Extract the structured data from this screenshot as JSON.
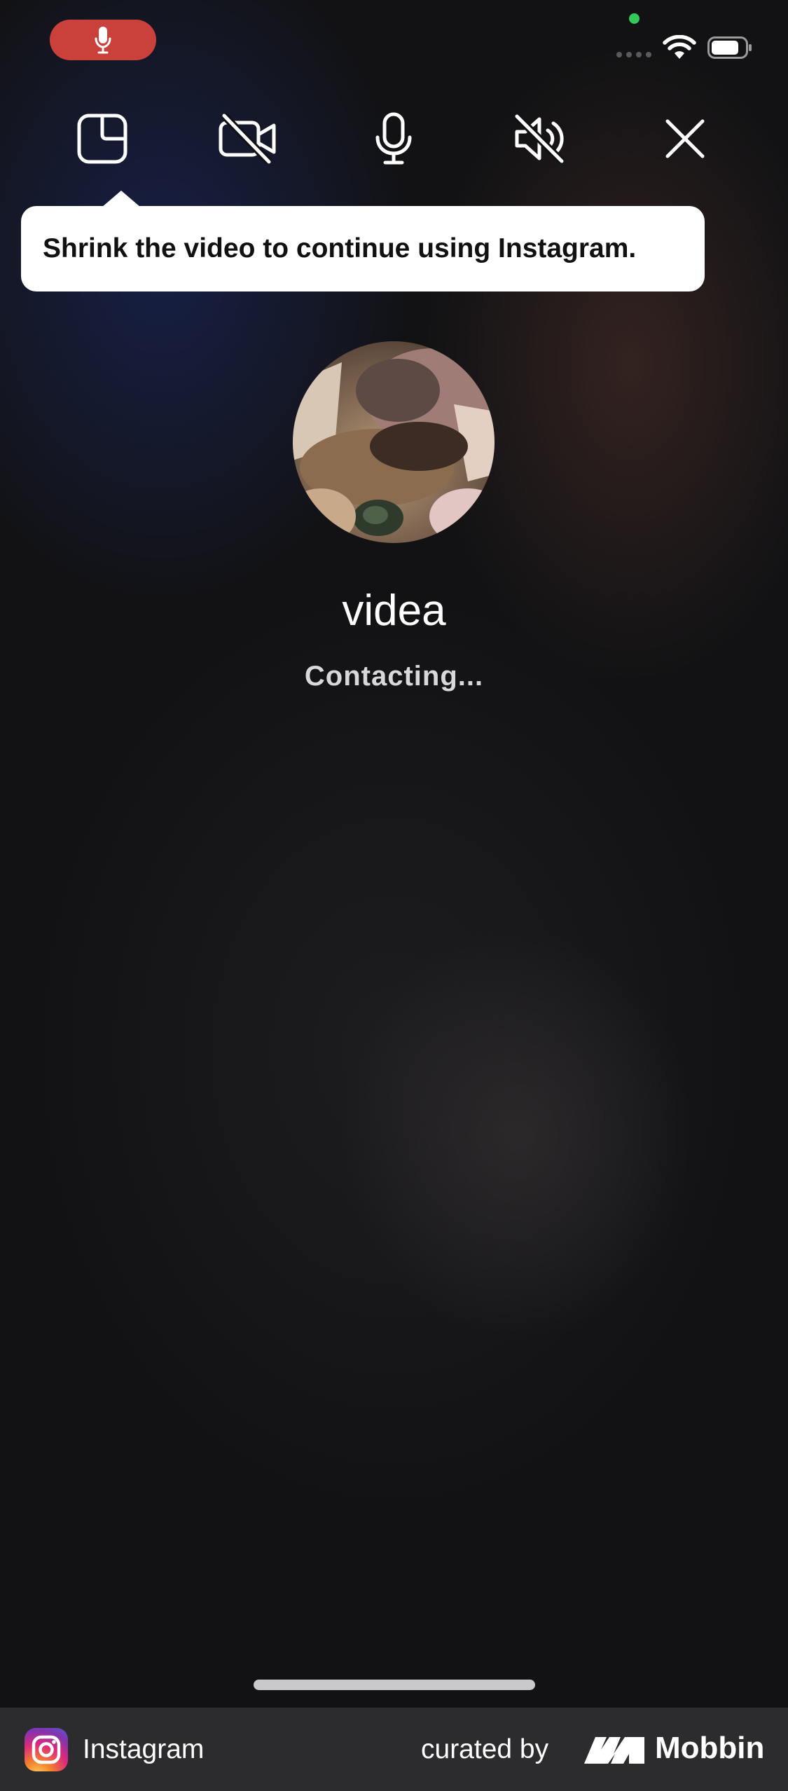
{
  "status_bar": {
    "mic_indicator_icon": "microphone-icon",
    "privacy_dot_color": "#34c759",
    "recording_pill_color": "#c9413a"
  },
  "controls": [
    {
      "name": "minimize-video-button",
      "icon": "picture-in-picture-icon"
    },
    {
      "name": "camera-off-button",
      "icon": "video-off-icon"
    },
    {
      "name": "microphone-button",
      "icon": "microphone-icon"
    },
    {
      "name": "speaker-mute-button",
      "icon": "speaker-muted-icon"
    },
    {
      "name": "end-call-button",
      "icon": "close-icon"
    }
  ],
  "tooltip": {
    "text": "Shrink the video to continue using Instagram."
  },
  "call": {
    "name": "videa",
    "status": "Contacting..."
  },
  "footer": {
    "app_name": "Instagram",
    "curated_by": "curated by",
    "brand": "Mobbin"
  }
}
